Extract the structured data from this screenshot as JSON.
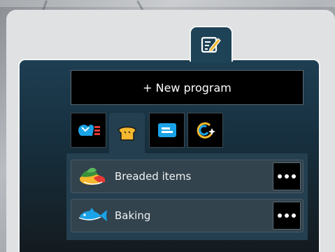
{
  "toolbar": {
    "new_program_label": "+ New program",
    "edit_icon": "edit-icon"
  },
  "category_tabs": [
    {
      "id": "tab-combination",
      "icon": "combination-cooking-icon",
      "active": false
    },
    {
      "id": "tab-bakery",
      "icon": "bread-icon",
      "active": true
    },
    {
      "id": "tab-custom",
      "icon": "list-card-icon",
      "active": false
    },
    {
      "id": "tab-special",
      "icon": "sparkle-cycle-icon",
      "active": false
    }
  ],
  "programs": [
    {
      "label": "Breaded items",
      "icon": "breaded-vegetables-icon"
    },
    {
      "label": "Baking",
      "icon": "fish-icon"
    }
  ],
  "colors": {
    "accent_yellow": "#f5b82e",
    "accent_blue": "#1aa3e8",
    "panel_dark": "#17303f"
  }
}
